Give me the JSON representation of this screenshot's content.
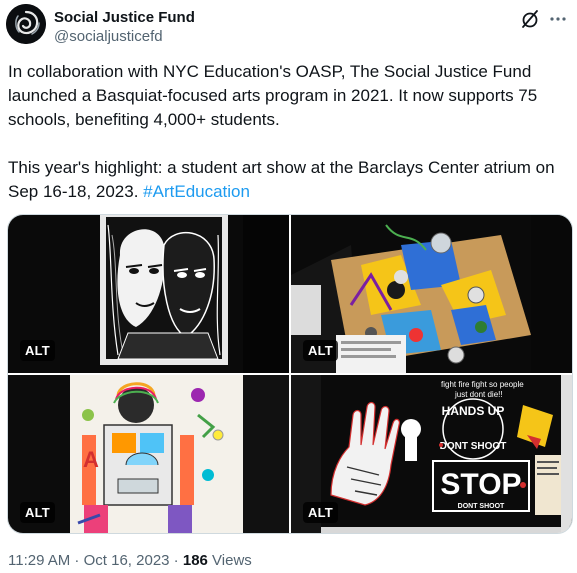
{
  "author": {
    "display_name": "Social Justice Fund",
    "handle": "@socialjusticefd",
    "avatar_icon": "swirl-logo-icon"
  },
  "actions": {
    "grok_icon": "grok-slash-icon",
    "more_icon": "more-dots-icon"
  },
  "tweet": {
    "paragraph_1": "In collaboration with NYC Education's OASP, The Social Justice Fund launched a Basquiat-focused arts program in 2021. It now supports 75 schools, benefiting 4,000+ students.",
    "paragraph_2_text": "This year's highlight: a student art show at the Barclays Center atrium on Sep 16-18, 2023. ",
    "hashtag": "#ArtEducation"
  },
  "media": [
    {
      "alt_label": "ALT"
    },
    {
      "alt_label": "ALT"
    },
    {
      "alt_label": "ALT"
    },
    {
      "alt_label": "ALT",
      "sign_text": "STOP",
      "sign_subtext": "DONT SHOOT",
      "arc_text": "HANDS UP",
      "arc_text_2": "DONT SHOOT",
      "top_note": "fight fire fight so people",
      "top_note_2": "just dont die!!"
    }
  ],
  "meta": {
    "time": "11:29 AM",
    "separator_1": " · ",
    "date": "Oct 16, 2023",
    "separator_2": " · ",
    "views_count": "186",
    "views_label": " Views"
  },
  "colors": {
    "text": "#0f1419",
    "secondary": "#536471",
    "link": "#1d9bf0",
    "border": "#cfd9de"
  }
}
